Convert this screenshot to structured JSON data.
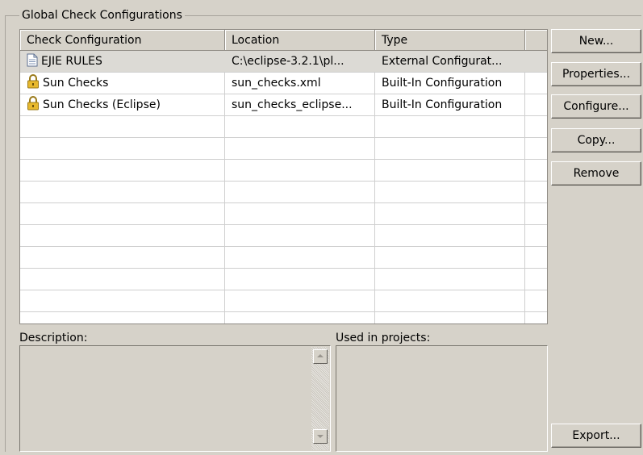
{
  "group_title": "Global Check Configurations",
  "table": {
    "columns": [
      "Check Configuration",
      "Location",
      "Type",
      ""
    ],
    "rows": [
      {
        "name": "EJIE RULES",
        "location": "C:\\eclipse-3.2.1\\pl...",
        "type": "External Configurat...",
        "icon": "document-icon",
        "selected": true
      },
      {
        "name": "Sun Checks",
        "location": "sun_checks.xml",
        "type": "Built-In Configuration",
        "icon": "lock-icon",
        "selected": false
      },
      {
        "name": "Sun Checks (Eclipse)",
        "location": "sun_checks_eclipse...",
        "type": "Built-In Configuration",
        "icon": "lock-icon",
        "selected": false
      }
    ]
  },
  "buttons": {
    "new": "New...",
    "properties": "Properties...",
    "configure": "Configure...",
    "copy": "Copy...",
    "remove": "Remove",
    "export": "Export..."
  },
  "description_label": "Description:",
  "used_in_projects_label": "Used in projects:"
}
